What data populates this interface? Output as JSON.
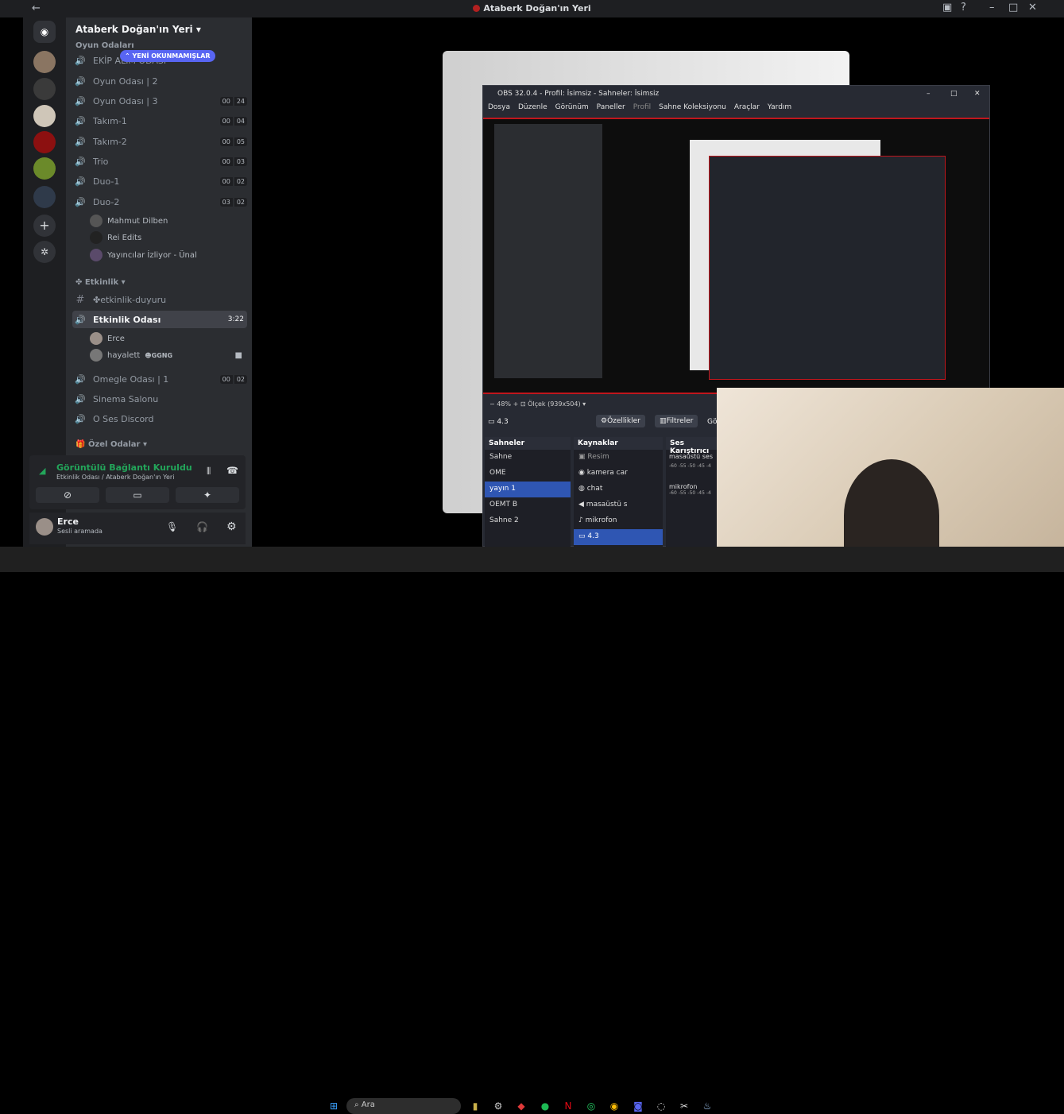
{
  "window": {
    "title": "Ataberk Doğan'ın Yeri"
  },
  "guild": {
    "name": "Ataberk Doğan'ın Yeri",
    "category_game": "Oyun Odaları",
    "unread_pill": "YENİ OKUNMAMIŞLAR"
  },
  "channels": [
    {
      "name": "EKİP ALIM ODASI",
      "c1": "",
      "c2": ""
    },
    {
      "name": "Oyun Odası | 2",
      "c1": "",
      "c2": ""
    },
    {
      "name": "Oyun Odası | 3",
      "c1": "00",
      "c2": "24"
    },
    {
      "name": "Takım-1",
      "c1": "00",
      "c2": "04"
    },
    {
      "name": "Takım-2",
      "c1": "00",
      "c2": "05"
    },
    {
      "name": "Trio",
      "c1": "00",
      "c2": "03"
    },
    {
      "name": "Duo-1",
      "c1": "00",
      "c2": "02"
    },
    {
      "name": "Duo-2",
      "c1": "03",
      "c2": "02"
    }
  ],
  "duo2_users": [
    "Mahmut Dilben",
    "Rei Edits",
    "Yayıncılar İzliyor - Ünal"
  ],
  "category_event": "Etkinlik",
  "event_text_channel": "etkinlik-duyuru",
  "event_voice": {
    "name": "Etkinlik Odası",
    "time": "3:22"
  },
  "event_users": [
    {
      "name": "Erce",
      "tag": ""
    },
    {
      "name": "hayalett",
      "tag": "GGNG"
    }
  ],
  "channels2": [
    {
      "name": "Omegle Odası | 1",
      "c1": "00",
      "c2": "02"
    },
    {
      "name": "Sinema Salonu",
      "c1": "",
      "c2": ""
    },
    {
      "name": "O Ses Discord",
      "c1": "",
      "c2": ""
    }
  ],
  "category_private": "Özel Odalar",
  "voice_connection": {
    "status": "Görüntülü Bağlantı Kuruldu",
    "location": "Etkinlik Odası / Ataberk Doğan'ın Yeri"
  },
  "user": {
    "name": "Erce",
    "status": "Sesli aramada"
  },
  "obs": {
    "title": "OBS 32.0.4 - Profil: İsimsiz - Sahneler: İsimsiz",
    "menu": [
      "Dosya",
      "Düzenle",
      "Görünüm",
      "Paneller",
      "Profil",
      "Sahne Koleksiyonu",
      "Araçlar",
      "Yardım"
    ],
    "zoom": "48%",
    "scale": "Ölçek (939x504)",
    "source_name": "4.3",
    "properties": "Özellikler",
    "filters": "Filtreler",
    "more": "Gö",
    "scenes_title": "Sahneler",
    "scenes": [
      "Sahne",
      "OME",
      "yayın 1",
      "OEMT B",
      "Sahne 2"
    ],
    "scene_selected": 2,
    "sources_title": "Kaynaklar",
    "sources": [
      "Resim",
      "kamera car",
      "chat",
      "masaüstü s",
      "mikrofon",
      "4.3"
    ],
    "mixer_title": "Ses Karıştırıcı",
    "mixer": [
      {
        "name": "masaüstü ses"
      },
      {
        "name": "mikrofon"
      }
    ],
    "db_scale": "-60 -55 -50 -45 -4"
  },
  "taskbar": {
    "search": "Ara"
  }
}
